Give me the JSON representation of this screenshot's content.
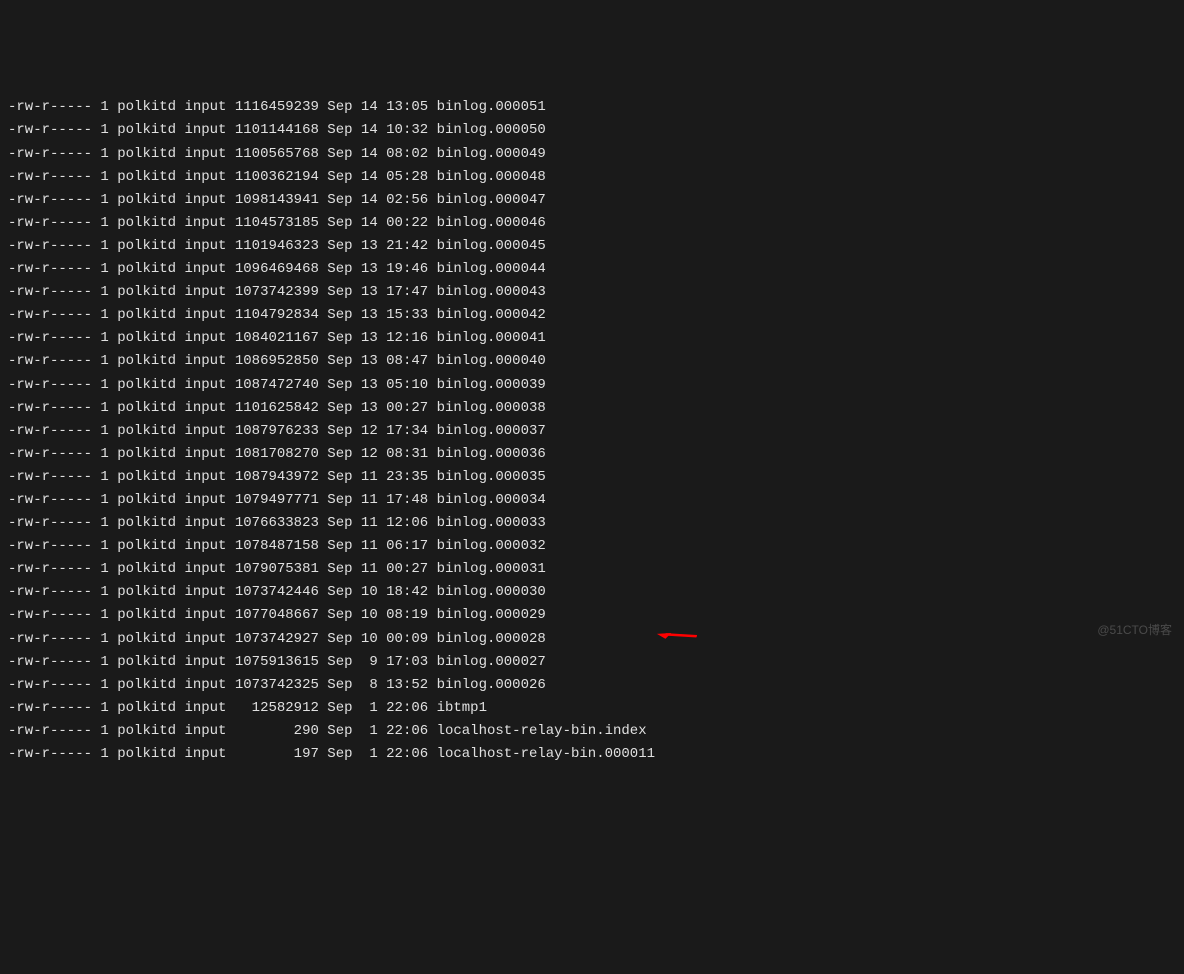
{
  "watermark": "@51CTO博客",
  "arrow_target_index": 24,
  "files": [
    {
      "perms": "-rw-r-----",
      "links": "1",
      "owner": "polkitd",
      "group": "input",
      "size": "1116459239",
      "month": "Sep",
      "day": "14",
      "time": "13:05",
      "name": "binlog.000051"
    },
    {
      "perms": "-rw-r-----",
      "links": "1",
      "owner": "polkitd",
      "group": "input",
      "size": "1101144168",
      "month": "Sep",
      "day": "14",
      "time": "10:32",
      "name": "binlog.000050"
    },
    {
      "perms": "-rw-r-----",
      "links": "1",
      "owner": "polkitd",
      "group": "input",
      "size": "1100565768",
      "month": "Sep",
      "day": "14",
      "time": "08:02",
      "name": "binlog.000049"
    },
    {
      "perms": "-rw-r-----",
      "links": "1",
      "owner": "polkitd",
      "group": "input",
      "size": "1100362194",
      "month": "Sep",
      "day": "14",
      "time": "05:28",
      "name": "binlog.000048"
    },
    {
      "perms": "-rw-r-----",
      "links": "1",
      "owner": "polkitd",
      "group": "input",
      "size": "1098143941",
      "month": "Sep",
      "day": "14",
      "time": "02:56",
      "name": "binlog.000047"
    },
    {
      "perms": "-rw-r-----",
      "links": "1",
      "owner": "polkitd",
      "group": "input",
      "size": "1104573185",
      "month": "Sep",
      "day": "14",
      "time": "00:22",
      "name": "binlog.000046"
    },
    {
      "perms": "-rw-r-----",
      "links": "1",
      "owner": "polkitd",
      "group": "input",
      "size": "1101946323",
      "month": "Sep",
      "day": "13",
      "time": "21:42",
      "name": "binlog.000045"
    },
    {
      "perms": "-rw-r-----",
      "links": "1",
      "owner": "polkitd",
      "group": "input",
      "size": "1096469468",
      "month": "Sep",
      "day": "13",
      "time": "19:46",
      "name": "binlog.000044"
    },
    {
      "perms": "-rw-r-----",
      "links": "1",
      "owner": "polkitd",
      "group": "input",
      "size": "1073742399",
      "month": "Sep",
      "day": "13",
      "time": "17:47",
      "name": "binlog.000043"
    },
    {
      "perms": "-rw-r-----",
      "links": "1",
      "owner": "polkitd",
      "group": "input",
      "size": "1104792834",
      "month": "Sep",
      "day": "13",
      "time": "15:33",
      "name": "binlog.000042"
    },
    {
      "perms": "-rw-r-----",
      "links": "1",
      "owner": "polkitd",
      "group": "input",
      "size": "1084021167",
      "month": "Sep",
      "day": "13",
      "time": "12:16",
      "name": "binlog.000041"
    },
    {
      "perms": "-rw-r-----",
      "links": "1",
      "owner": "polkitd",
      "group": "input",
      "size": "1086952850",
      "month": "Sep",
      "day": "13",
      "time": "08:47",
      "name": "binlog.000040"
    },
    {
      "perms": "-rw-r-----",
      "links": "1",
      "owner": "polkitd",
      "group": "input",
      "size": "1087472740",
      "month": "Sep",
      "day": "13",
      "time": "05:10",
      "name": "binlog.000039"
    },
    {
      "perms": "-rw-r-----",
      "links": "1",
      "owner": "polkitd",
      "group": "input",
      "size": "1101625842",
      "month": "Sep",
      "day": "13",
      "time": "00:27",
      "name": "binlog.000038"
    },
    {
      "perms": "-rw-r-----",
      "links": "1",
      "owner": "polkitd",
      "group": "input",
      "size": "1087976233",
      "month": "Sep",
      "day": "12",
      "time": "17:34",
      "name": "binlog.000037"
    },
    {
      "perms": "-rw-r-----",
      "links": "1",
      "owner": "polkitd",
      "group": "input",
      "size": "1081708270",
      "month": "Sep",
      "day": "12",
      "time": "08:31",
      "name": "binlog.000036"
    },
    {
      "perms": "-rw-r-----",
      "links": "1",
      "owner": "polkitd",
      "group": "input",
      "size": "1087943972",
      "month": "Sep",
      "day": "11",
      "time": "23:35",
      "name": "binlog.000035"
    },
    {
      "perms": "-rw-r-----",
      "links": "1",
      "owner": "polkitd",
      "group": "input",
      "size": "1079497771",
      "month": "Sep",
      "day": "11",
      "time": "17:48",
      "name": "binlog.000034"
    },
    {
      "perms": "-rw-r-----",
      "links": "1",
      "owner": "polkitd",
      "group": "input",
      "size": "1076633823",
      "month": "Sep",
      "day": "11",
      "time": "12:06",
      "name": "binlog.000033"
    },
    {
      "perms": "-rw-r-----",
      "links": "1",
      "owner": "polkitd",
      "group": "input",
      "size": "1078487158",
      "month": "Sep",
      "day": "11",
      "time": "06:17",
      "name": "binlog.000032"
    },
    {
      "perms": "-rw-r-----",
      "links": "1",
      "owner": "polkitd",
      "group": "input",
      "size": "1079075381",
      "month": "Sep",
      "day": "11",
      "time": "00:27",
      "name": "binlog.000031"
    },
    {
      "perms": "-rw-r-----",
      "links": "1",
      "owner": "polkitd",
      "group": "input",
      "size": "1073742446",
      "month": "Sep",
      "day": "10",
      "time": "18:42",
      "name": "binlog.000030"
    },
    {
      "perms": "-rw-r-----",
      "links": "1",
      "owner": "polkitd",
      "group": "input",
      "size": "1077048667",
      "month": "Sep",
      "day": "10",
      "time": "08:19",
      "name": "binlog.000029"
    },
    {
      "perms": "-rw-r-----",
      "links": "1",
      "owner": "polkitd",
      "group": "input",
      "size": "1073742927",
      "month": "Sep",
      "day": "10",
      "time": "00:09",
      "name": "binlog.000028"
    },
    {
      "perms": "-rw-r-----",
      "links": "1",
      "owner": "polkitd",
      "group": "input",
      "size": "1075913615",
      "month": "Sep",
      "day": " 9",
      "time": "17:03",
      "name": "binlog.000027"
    },
    {
      "perms": "-rw-r-----",
      "links": "1",
      "owner": "polkitd",
      "group": "input",
      "size": "1073742325",
      "month": "Sep",
      "day": " 8",
      "time": "13:52",
      "name": "binlog.000026"
    },
    {
      "perms": "-rw-r-----",
      "links": "1",
      "owner": "polkitd",
      "group": "input",
      "size": "  12582912",
      "month": "Sep",
      "day": " 1",
      "time": "22:06",
      "name": "ibtmp1"
    },
    {
      "perms": "-rw-r-----",
      "links": "1",
      "owner": "polkitd",
      "group": "input",
      "size": "       290",
      "month": "Sep",
      "day": " 1",
      "time": "22:06",
      "name": "localhost-relay-bin.index"
    },
    {
      "perms": "-rw-r-----",
      "links": "1",
      "owner": "polkitd",
      "group": "input",
      "size": "       197",
      "month": "Sep",
      "day": " 1",
      "time": "22:06",
      "name": "localhost-relay-bin.000011"
    }
  ]
}
